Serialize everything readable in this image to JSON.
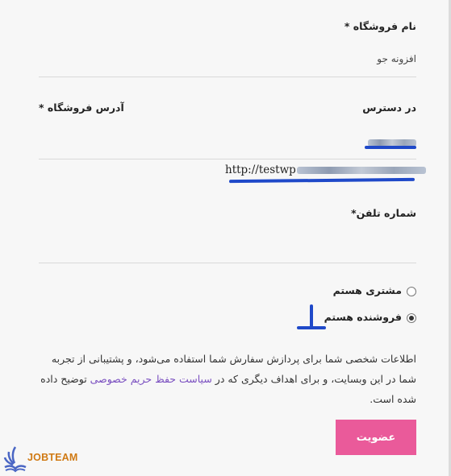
{
  "form": {
    "store_name_label": "نام فروشگاه *",
    "store_name_value": "افزونه جو",
    "store_address_label": "آدرس فروشگاه *",
    "available_label": "در دسترس",
    "store_url_prefix": "http://testwp",
    "phone_label": "شماره تلفن*",
    "role_customer_label": "مشتری هستم",
    "role_vendor_label": "فروشنده هستم",
    "role_selected": "فروشنده هستم",
    "privacy_text_before": "اطلاعات شخصی شما برای پردازش سفارش شما استفاده می‌شود، و پشتیبانی از تجربه شما در این وبسایت، و برای اهداف دیگری که در",
    "privacy_link": "سیاست حفظ حریم خصوصی",
    "privacy_text_after": "توضیح داده شده است.",
    "submit_label": "عضویت"
  },
  "branding": {
    "logo_text": "JOBTEAM"
  },
  "colors": {
    "accent_button": "#ea5a9a",
    "link": "#7a4fc0",
    "annotation_ink": "#1f49c9",
    "logo": "#d07a14"
  }
}
